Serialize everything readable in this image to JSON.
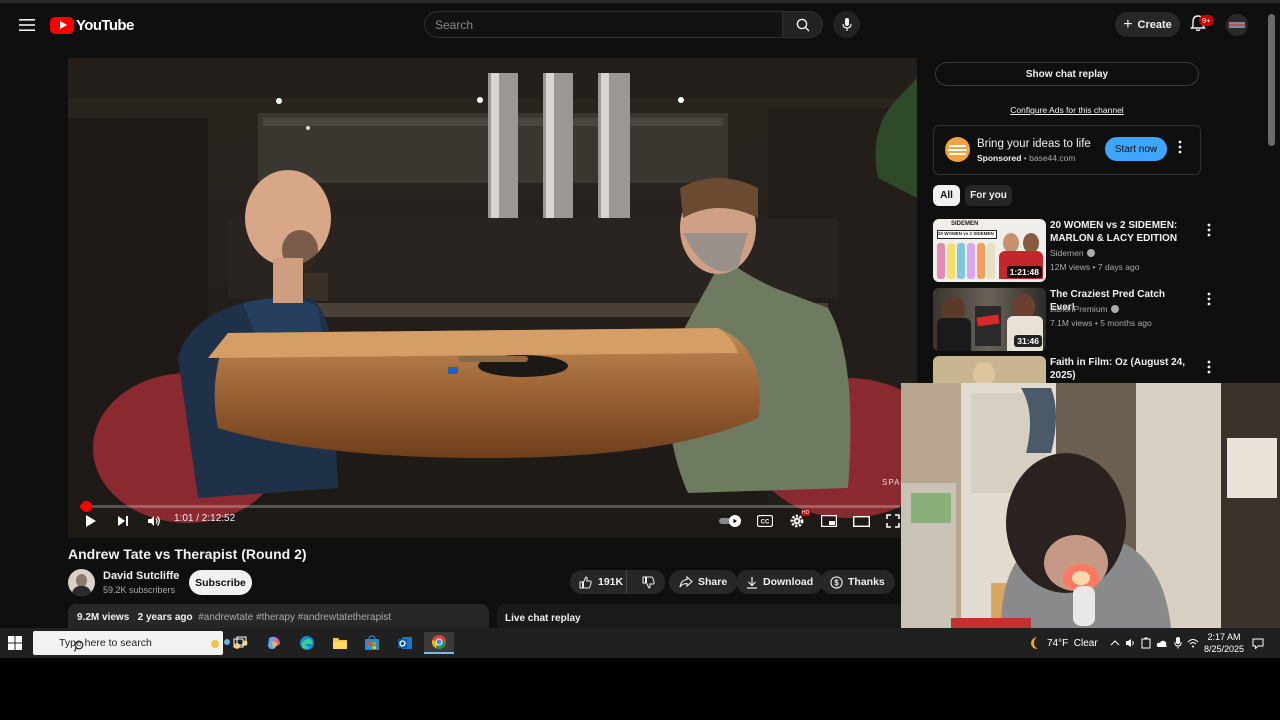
{
  "header": {
    "logo_text": "YouTube",
    "search_placeholder": "Search",
    "create_label": "Create",
    "notification_count": "9+"
  },
  "player": {
    "time_display": "1:01 / 2:12:52",
    "progress_fraction": 0.0077,
    "watermark": "SPAC",
    "hd_badge": "HD"
  },
  "video": {
    "title": "Andrew Tate vs Therapist (Round 2)",
    "channel_name": "David Sutcliffe",
    "subscribers": "59.2K subscribers",
    "subscribe_label": "Subscribe",
    "like_count": "191K",
    "share_label": "Share",
    "download_label": "Download",
    "thanks_label": "Thanks",
    "views": "9.2M views",
    "age": "2 years ago",
    "hashtags": "#andrewtate #therapy #andrewtatetherapist",
    "live_chat_label": "Live chat replay"
  },
  "sidebar": {
    "show_chat_replay": "Show chat replay",
    "configure_ads": "Configure Ads for this channel",
    "ad": {
      "title": "Bring your ideas to life",
      "sponsored": "Sponsored",
      "domain": "base44.com",
      "cta": "Start now"
    },
    "chips": [
      {
        "label": "All",
        "active": true
      },
      {
        "label": "For you",
        "active": false
      }
    ],
    "recommendations": [
      {
        "title": "20 WOMEN vs 2 SIDEMEN: MARLON & LACY EDITION",
        "channel": "Sidemen",
        "meta": "12M views • 7 days ago",
        "duration": "1:21:48",
        "thumb_text": "20 WOMEN vs 2 SIDEMEN",
        "thumb_brand": "SIDEMEN"
      },
      {
        "title": "The Craziest Pred Catch Ever!",
        "channel": "JiDionPremium",
        "meta": "7.1M views • 5 months ago",
        "duration": "31:46"
      },
      {
        "title": "Faith in Film: Oz (August 24, 2025)",
        "channel": "",
        "meta": "",
        "duration": ""
      }
    ]
  },
  "taskbar": {
    "search_placeholder": "Type here to search",
    "weather": "74°F  Clear",
    "time": "2:17 AM",
    "date": "8/25/2025"
  }
}
